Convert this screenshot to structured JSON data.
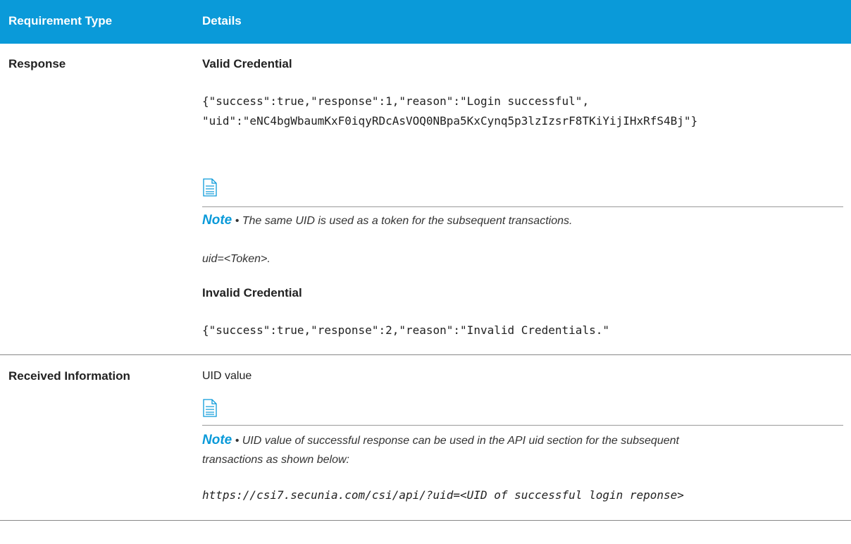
{
  "header": {
    "col1": "Requirement Type",
    "col2": "Details"
  },
  "row1": {
    "label": "Response",
    "valid_heading": "Valid Credential",
    "valid_line1": "{\"success\":true,\"response\":1,\"reason\":\"Login successful\",",
    "valid_line2": "\"uid\":\"eNC4bgWbaumKxF0iqyRDcAsVOQ0NBpa5KxCynq5p3lzIzsrF8TKiYijIHxRfS4Bj\"}",
    "note_icon": "note-icon",
    "note_label": "Note",
    "note_bullet": "•",
    "note_text": "The same UID is used as a token for the subsequent transactions.",
    "uid_token": "uid=<Token>.",
    "invalid_heading": "Invalid Credential",
    "invalid_line": "{\"success\":true,\"response\":2,\"reason\":\"Invalid Credentials.\""
  },
  "row2": {
    "label": "Received Information",
    "value": "UID value",
    "note_icon": "note-icon",
    "note_label": "Note",
    "note_bullet": "•",
    "note_text_line1": "UID value of successful response can be used in the API uid section for the subsequent",
    "note_text_line2": "transactions as shown below:",
    "url": "https://csi7.secunia.com/csi/api/?uid=<UID of successful login reponse>"
  },
  "colors": {
    "header_bg": "#0a9ad9",
    "note_label": "#0a9ad9"
  }
}
